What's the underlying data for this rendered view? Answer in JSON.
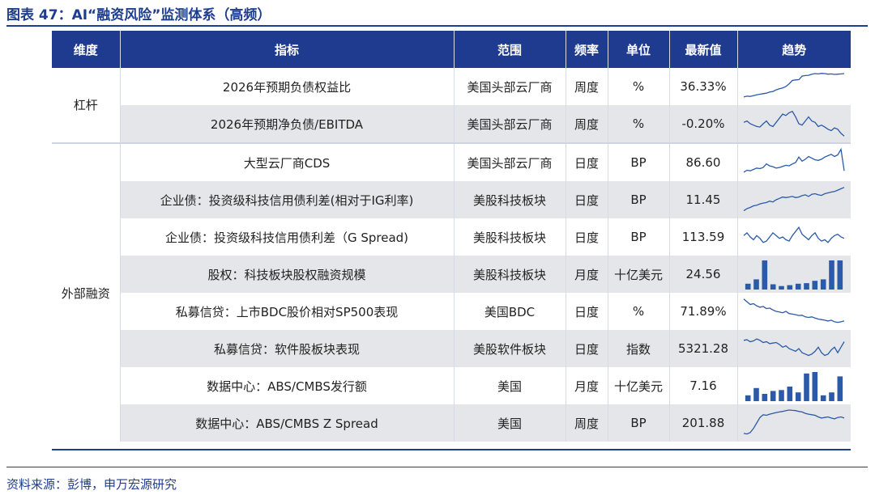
{
  "figure": {
    "title": "图表 47：AI“融资风险”监测体系（高频）",
    "source": "资料来源：彭博，申万宏源研究",
    "accent_color": "#1f3b8f",
    "shade_color": "#e5e6e9",
    "spark_color": "#2b5aa8"
  },
  "table": {
    "headers": [
      "维度",
      "指标",
      "范围",
      "频率",
      "单位",
      "最新值",
      "趋势"
    ],
    "groups": [
      {
        "dimension": "杠杆",
        "rows": [
          {
            "indicator": "2026年预期负债权益比",
            "scope": "美国头部云厂商",
            "frequency": "周度",
            "unit": "%",
            "latest": "36.33%",
            "trend_type": "line",
            "trend": [
              0.12,
              0.15,
              0.14,
              0.17,
              0.2,
              0.22,
              0.24,
              0.26,
              0.3,
              0.32,
              0.38,
              0.42,
              0.45,
              0.5,
              0.6,
              0.72,
              0.74,
              0.75,
              0.88,
              0.9,
              0.91,
              0.95,
              0.97,
              0.96,
              0.98,
              0.97,
              0.95,
              0.96,
              0.94,
              0.95,
              0.96,
              0.97
            ]
          },
          {
            "indicator": "2026年预期净负债/EBITDA",
            "scope": "美国头部云厂商",
            "frequency": "周度",
            "unit": "%",
            "latest": "-0.20%",
            "trend_type": "line",
            "trend": [
              0.55,
              0.6,
              0.5,
              0.45,
              0.4,
              0.38,
              0.5,
              0.6,
              0.45,
              0.4,
              0.55,
              0.7,
              0.85,
              0.8,
              0.9,
              0.95,
              0.75,
              0.5,
              0.45,
              0.6,
              0.75,
              0.6,
              0.55,
              0.4,
              0.45,
              0.38,
              0.3,
              0.25,
              0.35,
              0.3,
              0.15,
              0.05
            ]
          }
        ]
      },
      {
        "dimension": "外部融资",
        "rows": [
          {
            "indicator": "大型云厂商CDS",
            "scope": "美国头部云厂商",
            "frequency": "日度",
            "unit": "BP",
            "latest": "86.60",
            "trend_type": "line",
            "trend": [
              0.15,
              0.22,
              0.2,
              0.25,
              0.3,
              0.28,
              0.32,
              0.45,
              0.38,
              0.35,
              0.3,
              0.32,
              0.36,
              0.4,
              0.38,
              0.45,
              0.5,
              0.7,
              0.55,
              0.62,
              0.72,
              0.66,
              0.6,
              0.58,
              0.62,
              0.7,
              0.75,
              0.8,
              0.72,
              0.78,
              0.98,
              0.2
            ]
          },
          {
            "indicator": "企业债：投资级科技信用债利差(相对于IG利率)",
            "scope": "美股科技板块",
            "frequency": "日度",
            "unit": "BP",
            "latest": "11.45",
            "trend_type": "line",
            "trend": [
              0.1,
              0.18,
              0.22,
              0.28,
              0.3,
              0.35,
              0.38,
              0.4,
              0.45,
              0.42,
              0.5,
              0.55,
              0.6,
              0.58,
              0.6,
              0.62,
              0.58,
              0.6,
              0.65,
              0.68,
              0.62,
              0.7,
              0.72,
              0.68,
              0.66,
              0.72,
              0.75,
              0.78,
              0.8,
              0.85,
              0.9,
              0.95
            ]
          },
          {
            "indicator": "企业债：投资级科技信用债利差（G Spread)",
            "scope": "美股科技板块",
            "frequency": "日度",
            "unit": "BP",
            "latest": "113.59",
            "trend_type": "line",
            "trend": [
              0.55,
              0.65,
              0.5,
              0.4,
              0.55,
              0.45,
              0.3,
              0.35,
              0.5,
              0.65,
              0.55,
              0.45,
              0.5,
              0.4,
              0.35,
              0.55,
              0.7,
              0.85,
              0.6,
              0.5,
              0.4,
              0.55,
              0.65,
              0.45,
              0.35,
              0.4,
              0.3,
              0.45,
              0.55,
              0.6,
              0.5,
              0.45
            ]
          },
          {
            "indicator": "股权：科技板块股权融资规模",
            "scope": "美股科技板块",
            "frequency": "月度",
            "unit": "十亿美元",
            "latest": "24.56",
            "trend_type": "bar",
            "trend": [
              0.2,
              0.35,
              1.0,
              0.18,
              0.12,
              0.15,
              0.2,
              0.22,
              0.3,
              0.35,
              1.0,
              1.0
            ]
          },
          {
            "indicator": "私募信贷：上市BDC股价相对SP500表现",
            "scope": "美国BDC",
            "frequency": "日度",
            "unit": "%",
            "latest": "71.89%",
            "trend_type": "line",
            "trend": [
              0.95,
              0.85,
              0.75,
              0.78,
              0.7,
              0.65,
              0.68,
              0.6,
              0.62,
              0.55,
              0.5,
              0.48,
              0.45,
              0.5,
              0.42,
              0.4,
              0.38,
              0.35,
              0.36,
              0.3,
              0.28,
              0.3,
              0.26,
              0.22,
              0.2,
              0.18,
              0.15,
              0.18,
              0.12,
              0.1,
              0.12,
              0.15
            ]
          },
          {
            "indicator": "私募信贷：软件股板块表现",
            "scope": "美股软件板块",
            "frequency": "日度",
            "unit": "指数",
            "latest": "5321.28",
            "trend_type": "line",
            "trend": [
              0.8,
              0.82,
              0.75,
              0.78,
              0.85,
              0.8,
              0.72,
              0.75,
              0.68,
              0.7,
              0.72,
              0.65,
              0.55,
              0.6,
              0.5,
              0.45,
              0.4,
              0.5,
              0.35,
              0.3,
              0.25,
              0.3,
              0.4,
              0.55,
              0.35,
              0.25,
              0.3,
              0.45,
              0.55,
              0.35,
              0.55,
              0.75
            ]
          },
          {
            "indicator": "数据中心：ABS/CMBS发行额",
            "scope": "美国",
            "frequency": "月度",
            "unit": "十亿美元",
            "latest": "7.16",
            "trend_type": "bar",
            "trend": [
              0.2,
              0.45,
              0.25,
              0.35,
              0.38,
              0.5,
              0.3,
              0.95,
              1.0,
              0.2,
              0.3,
              0.85
            ]
          },
          {
            "indicator": "数据中心：ABS/CMBS Z Spread",
            "scope": "美国",
            "frequency": "周度",
            "unit": "BP",
            "latest": "201.88",
            "trend_type": "line",
            "trend": [
              0.12,
              0.1,
              0.15,
              0.3,
              0.5,
              0.7,
              0.8,
              0.78,
              0.82,
              0.85,
              0.88,
              0.9,
              0.92,
              0.95,
              0.97,
              0.96,
              0.95,
              0.92,
              0.9,
              0.85,
              0.82,
              0.8,
              0.78,
              0.72,
              0.68,
              0.7,
              0.72,
              0.68,
              0.65,
              0.7,
              0.72,
              0.68
            ]
          }
        ]
      }
    ]
  }
}
